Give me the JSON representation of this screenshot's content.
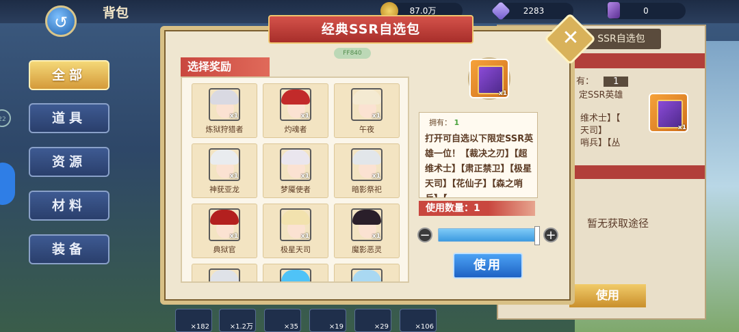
{
  "topbar": {
    "title": "背包",
    "gold": "87.0万",
    "diamonds": "2283",
    "crystals": "0"
  },
  "categories": [
    "全部",
    "道具",
    "资源",
    "材料",
    "装备"
  ],
  "side_badge": "22",
  "background_panel": {
    "title": "SSR自选包",
    "own_label": "有：",
    "own_value": "1",
    "line1": "定SSR英雄",
    "line2": "维术士】【",
    "line3": "天司】",
    "line4": "哨兵】【丛",
    "acquire": "暂无获取途径",
    "use": "使用"
  },
  "bottom_counts": [
    "×182",
    "×1.2万",
    "×35",
    "×19",
    "×29",
    "×106"
  ],
  "modal": {
    "title": "经典SSR自选包",
    "mini_pill": "FF840",
    "select_label": "选择奖励",
    "heroes": [
      {
        "name": "炼狱狩猎者",
        "hair": "#d9d9e2",
        "qty": "x1"
      },
      {
        "name": "灼魂者",
        "hair": "#c22a2a",
        "qty": "x1"
      },
      {
        "name": "午夜",
        "hair": "#f4ead2",
        "qty": "x1"
      },
      {
        "name": "神莸亚龙",
        "hair": "#e9ecef",
        "qty": "x1"
      },
      {
        "name": "梦魇使者",
        "hair": "#eae6ee",
        "qty": "x1"
      },
      {
        "name": "暗影祭祀",
        "hair": "#e2e6ea",
        "qty": "x1"
      },
      {
        "name": "典狱官",
        "hair": "#b3201f",
        "qty": "x1"
      },
      {
        "name": "极星天司",
        "hair": "#f2e2ae",
        "qty": "x1"
      },
      {
        "name": "魔影恶灵",
        "hair": "#2a1f2a",
        "qty": "x1"
      },
      {
        "name": "",
        "hair": "#dfe2e8",
        "qty": ""
      },
      {
        "name": "",
        "hair": "#4fc3f7",
        "qty": ""
      },
      {
        "name": "",
        "hair": "#a9d8f2",
        "qty": ""
      }
    ],
    "item_qty": "x1",
    "own_label": "拥有：",
    "own_value": "1",
    "description": "打开可自选以下限定SSR英雄一位！【裁决之刃】【超维术士】【肃正禁卫】【极星天司】【花仙子】【森之哨兵】【",
    "qty_label": "使用数量：1",
    "quantity_fraction": 1.0,
    "minus": "−",
    "plus": "+",
    "use_button": "使用"
  },
  "colors": {
    "banner_red": "#b8362f",
    "use_blue": "#2f7fe0",
    "panel_cream": "#efe6d0",
    "gold_frame": "#d8c086"
  }
}
